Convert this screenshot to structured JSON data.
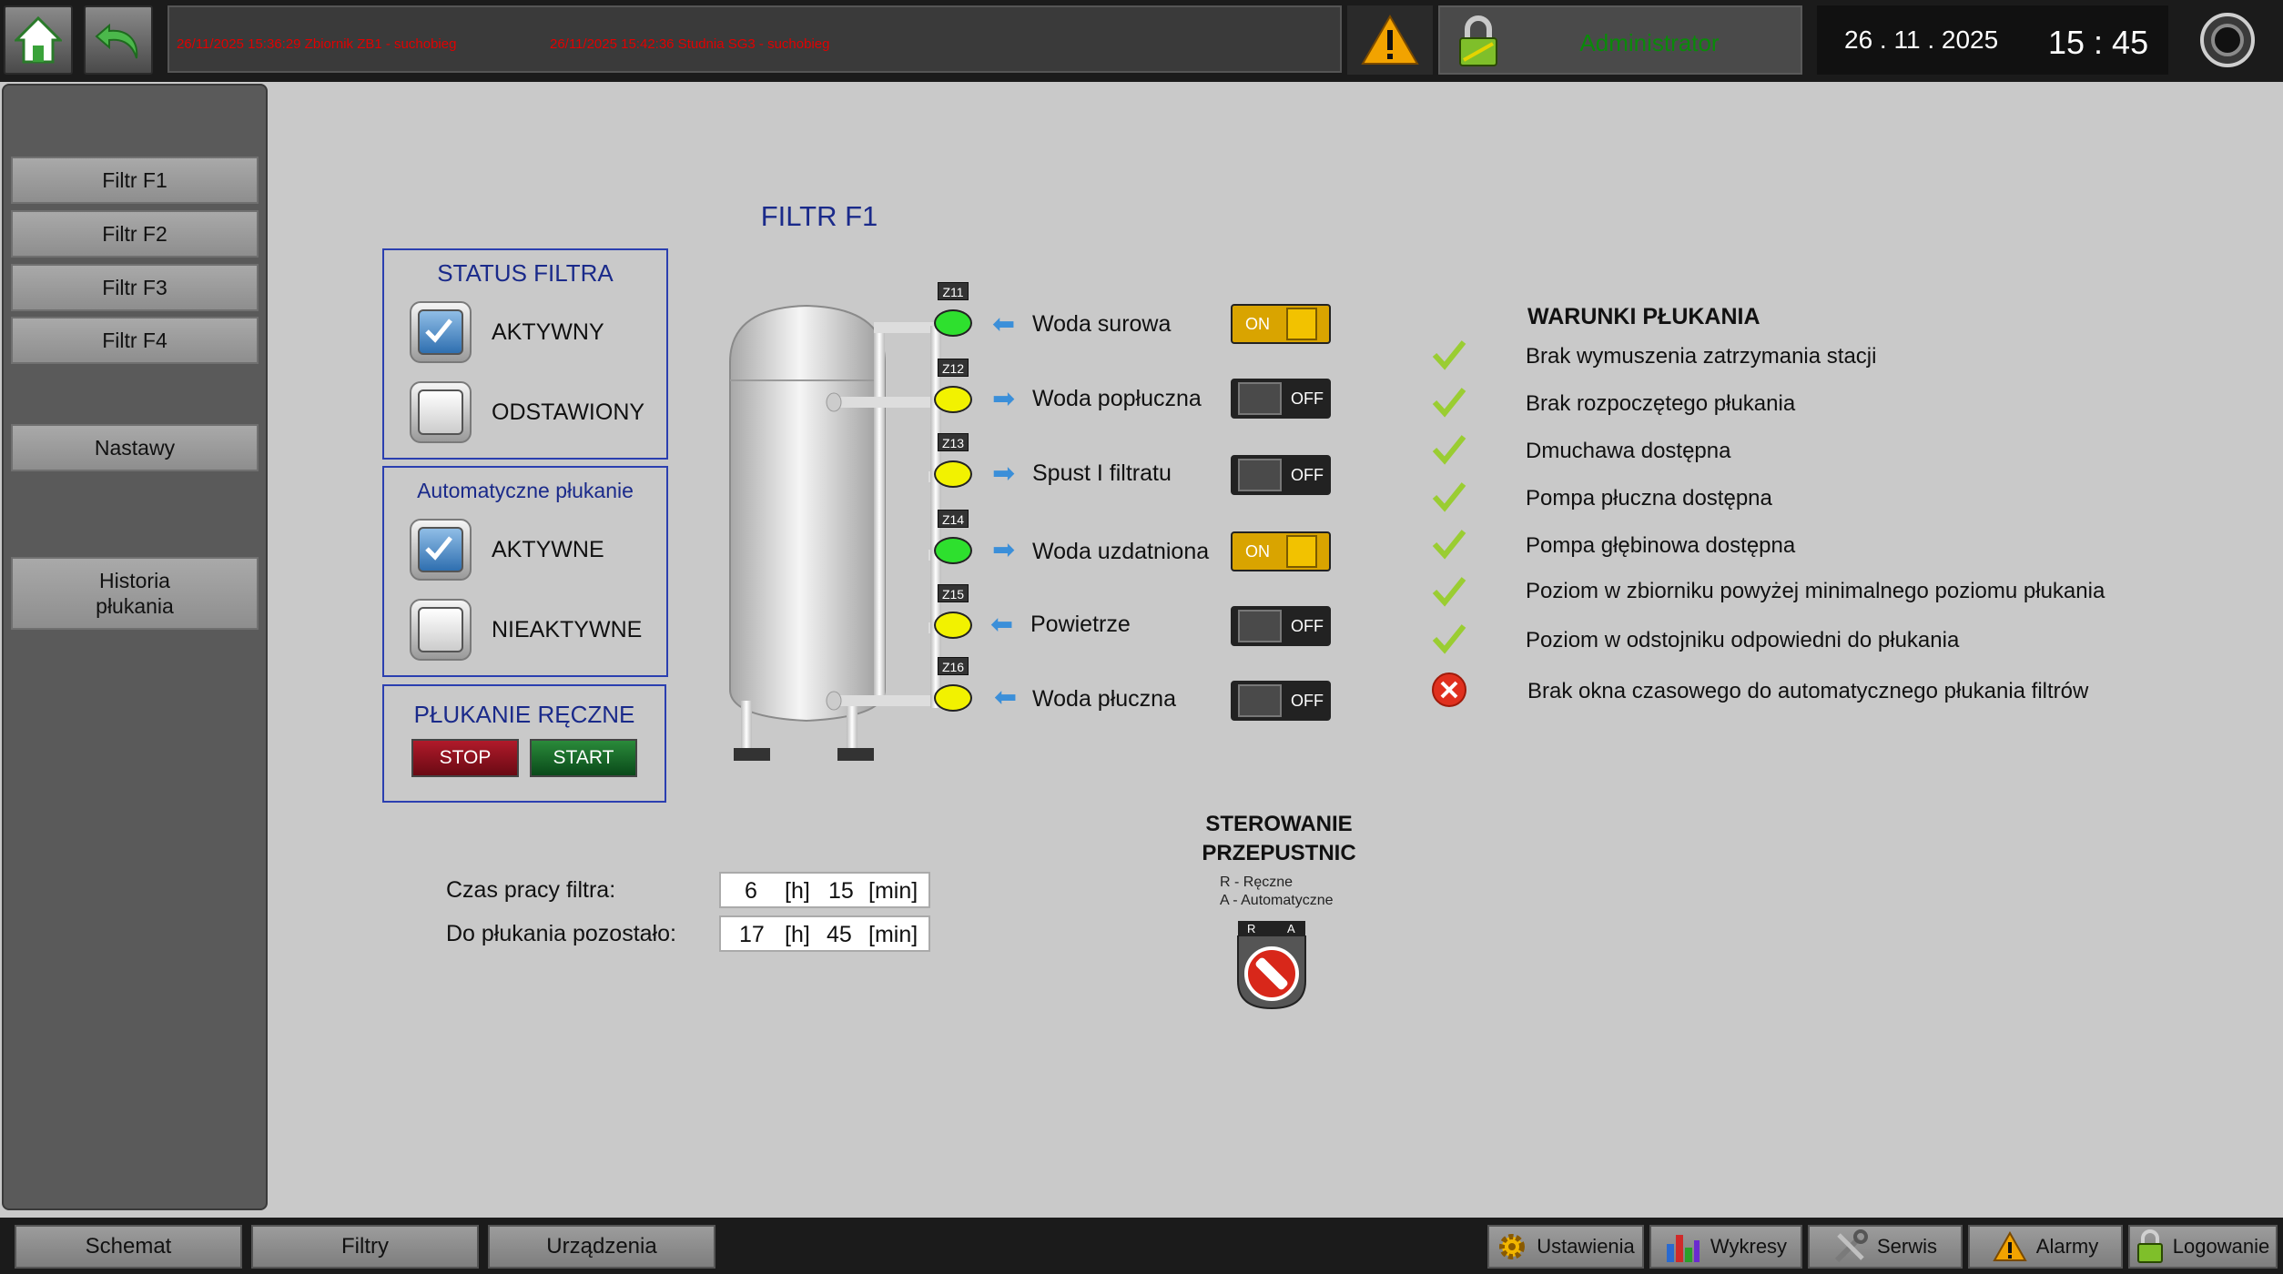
{
  "topbar": {
    "alarms": [
      "26/11/2025 15:36:29 Zbiornik ZB1 - suchobieg",
      "26/11/2025 15:42:36 Studnia SG3 - suchobieg"
    ],
    "user": "Administrator",
    "date": "26 . 11 . 2025",
    "time": "15 : 45"
  },
  "sidebar": {
    "items": [
      "Filtr F1",
      "Filtr F2",
      "Filtr F3",
      "Filtr F4",
      "Nastawy",
      "Historia\npłukania"
    ]
  },
  "main": {
    "title": "FILTR F1",
    "status_panel": {
      "title": "STATUS FILTRA",
      "options": [
        {
          "label": "AKTYWNY",
          "checked": true
        },
        {
          "label": "ODSTAWIONY",
          "checked": false
        }
      ]
    },
    "auto_panel": {
      "title": "Automatyczne płukanie",
      "options": [
        {
          "label": "AKTYWNE",
          "checked": true
        },
        {
          "label": "NIEAKTYWNE",
          "checked": false
        }
      ]
    },
    "manual_panel": {
      "title": "PŁUKANIE RĘCZNE",
      "stop": "STOP",
      "start": "START"
    },
    "valves": [
      {
        "tag": "Z11",
        "label": "Woda surowa",
        "color": "#2ee02e",
        "dir": "left",
        "state": "ON"
      },
      {
        "tag": "Z12",
        "label": "Woda popłuczna",
        "color": "#f2f200",
        "dir": "right",
        "state": "OFF"
      },
      {
        "tag": "Z13",
        "label": "Spust I filtratu",
        "color": "#f2f200",
        "dir": "right",
        "state": "OFF"
      },
      {
        "tag": "Z14",
        "label": "Woda uzdatniona",
        "color": "#2ee02e",
        "dir": "right",
        "state": "ON"
      },
      {
        "tag": "Z15",
        "label": "Powietrze",
        "color": "#f2f200",
        "dir": "left",
        "state": "OFF"
      },
      {
        "tag": "Z16",
        "label": "Woda płuczna",
        "color": "#f2f200",
        "dir": "left",
        "state": "OFF"
      }
    ],
    "conditions": {
      "title": "WARUNKI PŁUKANIA",
      "items": [
        {
          "text": "Brak wymuszenia zatrzymania stacji",
          "ok": true
        },
        {
          "text": "Brak rozpoczętego płukania",
          "ok": true
        },
        {
          "text": "Dmuchawa dostępna",
          "ok": true
        },
        {
          "text": "Pompa płuczna dostępna",
          "ok": true
        },
        {
          "text": "Pompa głębinowa dostępna",
          "ok": true
        },
        {
          "text": "Poziom w zbiorniku powyżej minimalnego poziomu płukania",
          "ok": true
        },
        {
          "text": "Poziom w odstojniku odpowiedni do płukania",
          "ok": true
        },
        {
          "text": "Brak okna czasowego do automatycznego płukania filtrów",
          "ok": false
        }
      ]
    },
    "times": {
      "work_label": "Czas pracy filtra:",
      "work_h": "6",
      "work_min": "15",
      "remain_label": "Do płukania pozostało:",
      "remain_h": "17",
      "remain_min": "45",
      "unit_h": "[h]",
      "unit_min": "[min]"
    },
    "control": {
      "title_line1": "STEROWANIE",
      "title_line2": "PRZEPUSTNIC",
      "legend_r": "R - Ręczne",
      "legend_a": "A - Automatyczne",
      "r": "R",
      "a": "A"
    }
  },
  "bottombar": {
    "nav": [
      "Schemat",
      "Filtry",
      "Urządzenia"
    ],
    "right": [
      "Ustawienia",
      "Wykresy",
      "Serwis",
      "Alarmy",
      "Logowanie"
    ]
  }
}
